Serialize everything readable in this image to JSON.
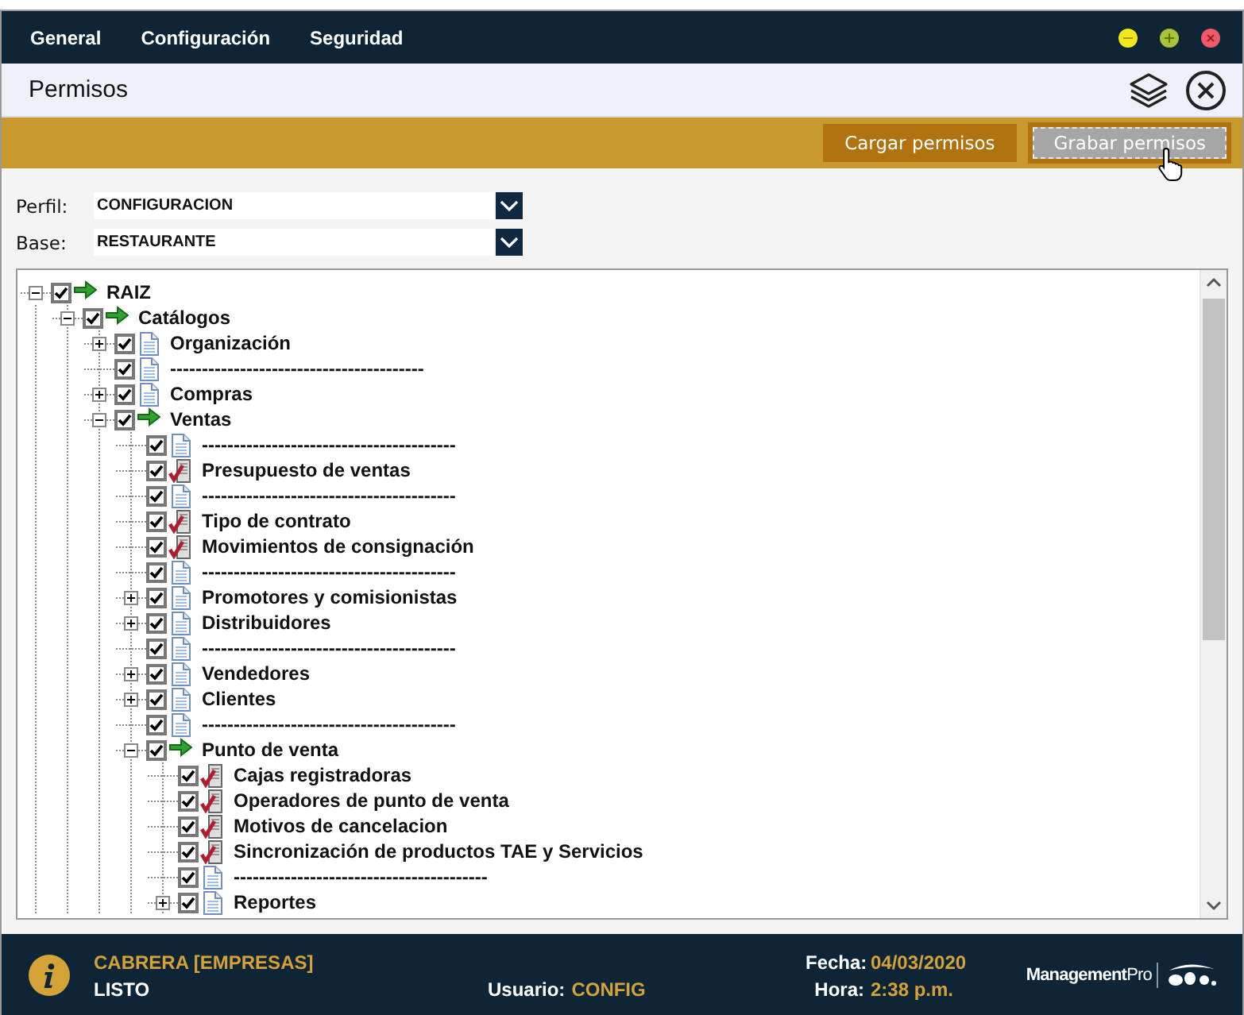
{
  "menu": [
    {
      "label": "General"
    },
    {
      "label": "Configuración"
    },
    {
      "label": "Seguridad"
    }
  ],
  "title": "Permisos",
  "toolbar": [
    {
      "label": "Cargar permisos",
      "focused": false
    },
    {
      "label": "Grabar permisos",
      "focused": true
    }
  ],
  "fields": [
    {
      "label": "Perfil:",
      "value": "CONFIGURACION"
    },
    {
      "label": "Base:",
      "value": "RESTAURANTE"
    }
  ],
  "tree": {
    "items": [
      {
        "label": "RAIZ",
        "kind": "folder",
        "checked": true,
        "expanded": true,
        "children": [
          {
            "label": "Catálogos",
            "kind": "folder",
            "checked": true,
            "expanded": true,
            "children": [
              {
                "label": "Organización",
                "kind": "doc",
                "checked": true,
                "expanded": false
              },
              {
                "label": "----------------------------------------",
                "kind": "doc",
                "checked": true
              },
              {
                "label": "Compras",
                "kind": "doc",
                "checked": true,
                "expanded": false
              },
              {
                "label": "Ventas",
                "kind": "folder",
                "checked": true,
                "expanded": true,
                "children": [
                  {
                    "label": "----------------------------------------",
                    "kind": "doc",
                    "checked": true
                  },
                  {
                    "label": "Presupuesto de ventas",
                    "kind": "form",
                    "checked": true
                  },
                  {
                    "label": "----------------------------------------",
                    "kind": "doc",
                    "checked": true
                  },
                  {
                    "label": "Tipo de contrato",
                    "kind": "form",
                    "checked": true
                  },
                  {
                    "label": "Movimientos de consignación",
                    "kind": "form",
                    "checked": true
                  },
                  {
                    "label": "----------------------------------------",
                    "kind": "doc",
                    "checked": true
                  },
                  {
                    "label": "Promotores y comisionistas",
                    "kind": "doc",
                    "checked": true,
                    "expanded": false
                  },
                  {
                    "label": "Distribuidores",
                    "kind": "doc",
                    "checked": true,
                    "expanded": false
                  },
                  {
                    "label": "----------------------------------------",
                    "kind": "doc",
                    "checked": true
                  },
                  {
                    "label": "Vendedores",
                    "kind": "doc",
                    "checked": true,
                    "expanded": false
                  },
                  {
                    "label": "Clientes",
                    "kind": "doc",
                    "checked": true,
                    "expanded": false
                  },
                  {
                    "label": "----------------------------------------",
                    "kind": "doc",
                    "checked": true
                  },
                  {
                    "label": "Punto de venta",
                    "kind": "folder",
                    "checked": true,
                    "expanded": true,
                    "children": [
                      {
                        "label": "Cajas registradoras",
                        "kind": "form",
                        "checked": true
                      },
                      {
                        "label": "Operadores de punto de venta",
                        "kind": "form",
                        "checked": true
                      },
                      {
                        "label": "Motivos de cancelacion",
                        "kind": "form",
                        "checked": true
                      },
                      {
                        "label": "Sincronización de productos TAE y Servicios",
                        "kind": "form",
                        "checked": true
                      },
                      {
                        "label": "----------------------------------------",
                        "kind": "doc",
                        "checked": true
                      },
                      {
                        "label": "Reportes",
                        "kind": "doc",
                        "checked": true,
                        "expanded": false
                      }
                    ]
                  }
                ]
              }
            ]
          }
        ]
      }
    ]
  },
  "status": {
    "company": "CABRERA [EMPRESAS]",
    "state": "LISTO",
    "user_label": "Usuario:",
    "user": "CONFIG",
    "date_label": "Fecha:",
    "date": "04/03/2020",
    "time_label": "Hora:",
    "time": "2:38 p.m.",
    "brand": "**Management**Pro"
  }
}
